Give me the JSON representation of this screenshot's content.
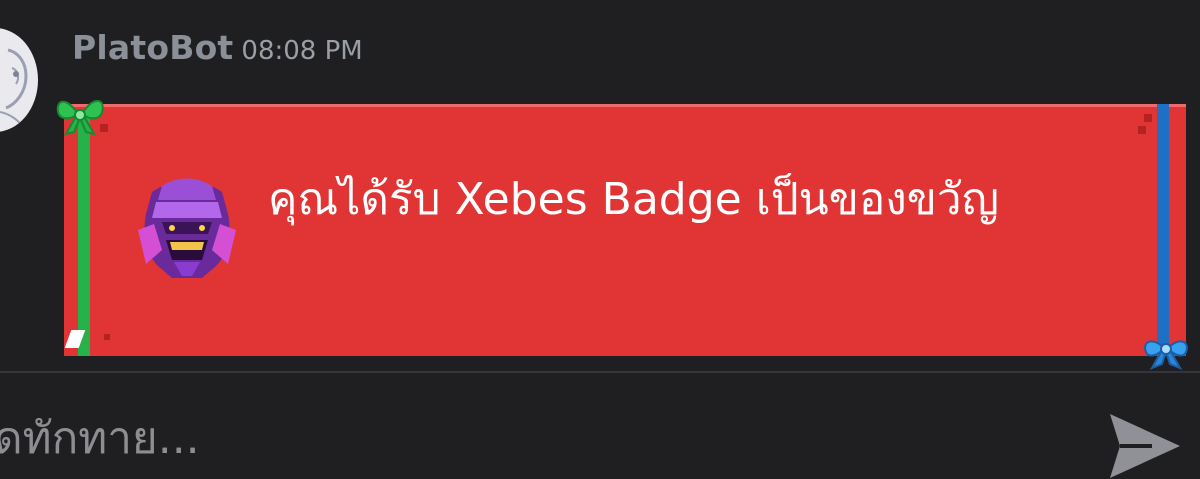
{
  "message": {
    "author": "PlatoBot",
    "timestamp": "08:08 PM",
    "avatar_icon": "owl-sketch-avatar"
  },
  "gift": {
    "text": "คุณได้รับ Xebes Badge เป็นของขวัญ",
    "badge_icon": "xebes-badge-icon",
    "card_color": "#e13434",
    "left_ribbon_color": "#27b14a",
    "right_ribbon_color": "#1f6fc4"
  },
  "composer": {
    "placeholder": "ดทักทาย...",
    "send_icon": "send-arrow-icon"
  }
}
